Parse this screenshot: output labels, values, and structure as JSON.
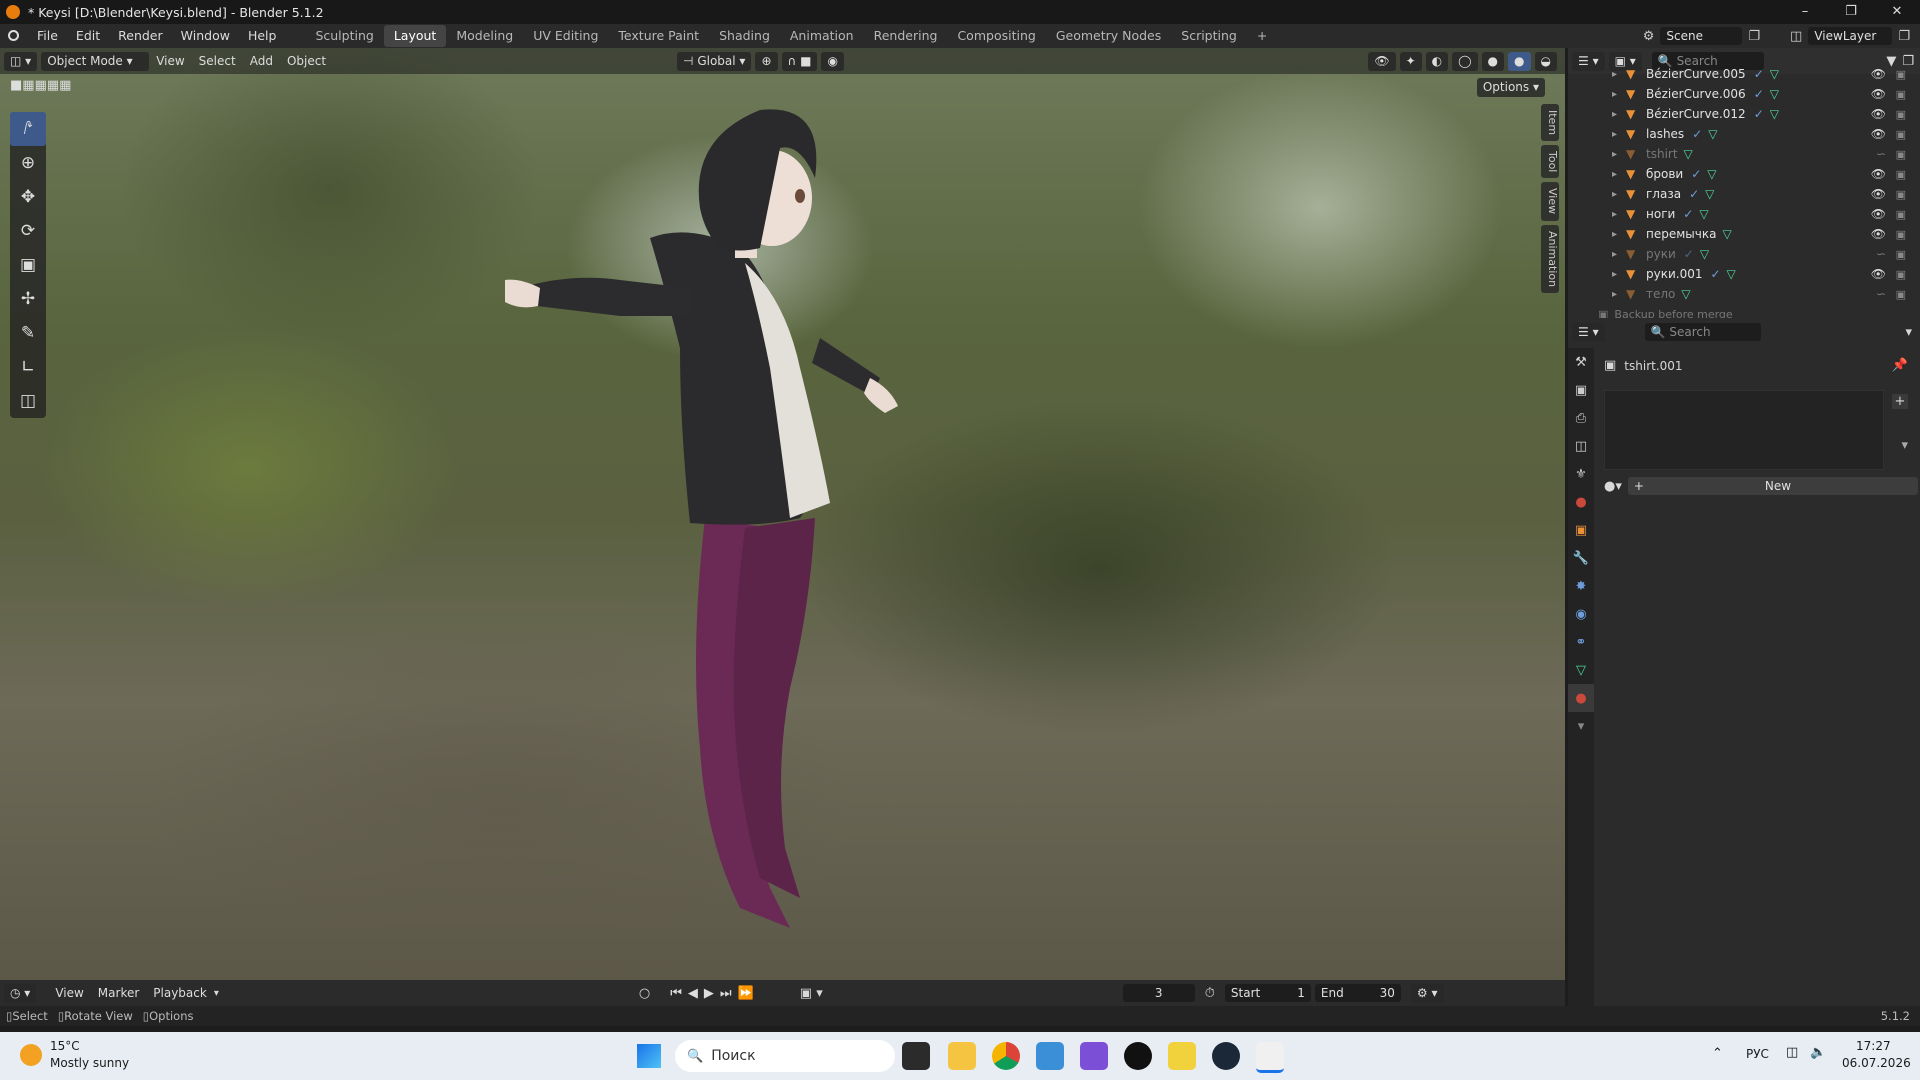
{
  "window": {
    "title": "* Keysi [D:\\Blender\\Keysi.blend] - Blender 5.1.2"
  },
  "menu": [
    "File",
    "Edit",
    "Render",
    "Window",
    "Help"
  ],
  "workspaces": [
    "Sculpting",
    "Layout",
    "Modeling",
    "UV Editing",
    "Texture Paint",
    "Shading",
    "Animation",
    "Rendering",
    "Compositing",
    "Geometry Nodes",
    "Scripting"
  ],
  "active_workspace": "Layout",
  "scene": {
    "name": "Scene",
    "view_layer": "ViewLayer"
  },
  "viewport_header": {
    "mode": "Object Mode",
    "menus": [
      "View",
      "Select",
      "Add",
      "Object"
    ],
    "transform": "Global",
    "options": "Options"
  },
  "viewport_tabs": [
    "Item",
    "Tool",
    "View",
    "Animation"
  ],
  "outliner": {
    "search_placeholder": "Search",
    "items": [
      {
        "name": "BézierCurve.005",
        "dim": false
      },
      {
        "name": "BézierCurve.006",
        "dim": false
      },
      {
        "name": "BézierCurve.012",
        "dim": false
      },
      {
        "name": "lashes",
        "dim": false
      },
      {
        "name": "tshirt",
        "dim": true
      },
      {
        "name": "брови",
        "dim": false
      },
      {
        "name": "глаза",
        "dim": false
      },
      {
        "name": "ноги",
        "dim": false
      },
      {
        "name": "перемычка",
        "dim": false
      },
      {
        "name": "руки",
        "dim": true
      },
      {
        "name": "руки.001",
        "dim": false
      },
      {
        "name": "тело",
        "dim": true
      },
      {
        "name": "Backup before merge",
        "dim": true
      }
    ]
  },
  "properties": {
    "search_placeholder": "Search",
    "object_name": "tshirt.001",
    "new_label": "New"
  },
  "timeline": {
    "menus": [
      "View",
      "Marker",
      "Playback"
    ],
    "current_frame": "3",
    "start_label": "Start",
    "start": "1",
    "end_label": "End",
    "end": "30"
  },
  "statusbar": {
    "select": "Select",
    "rotate": "Rotate View",
    "options": "Options",
    "version": "5.1.2"
  },
  "taskbar": {
    "weather_temp": "15°C",
    "weather_desc": "Mostly sunny",
    "search": "Поиск",
    "lang": "РУС",
    "time": "17:27",
    "date": "06.07.2026"
  },
  "colors": {
    "accent": "#3d5a8a",
    "outliner_icon": "#e8913a",
    "mesh_icon": "#4fd69b"
  }
}
